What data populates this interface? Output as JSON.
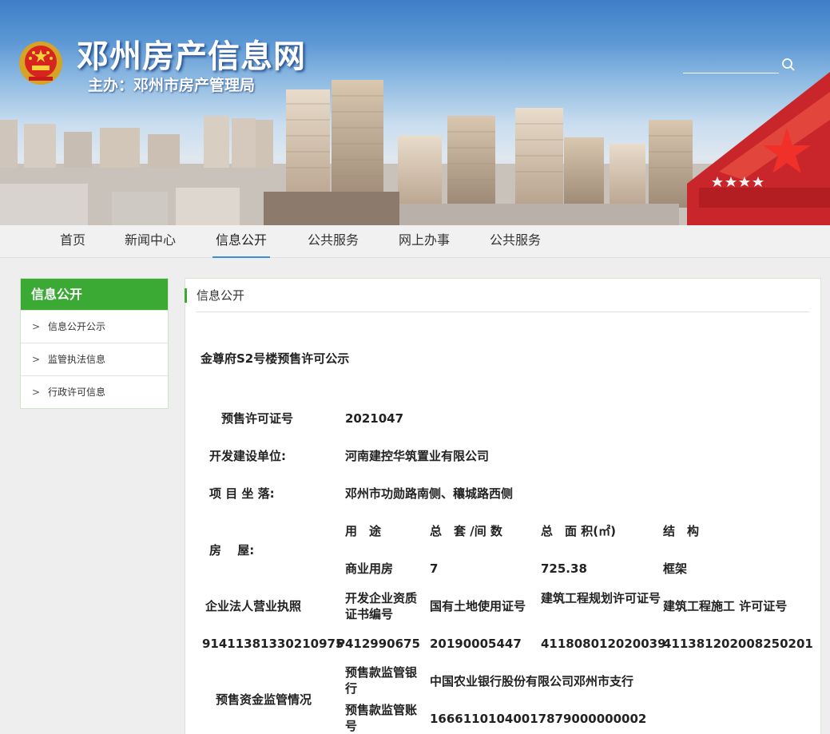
{
  "header": {
    "site_title": "邓州房产信息网",
    "subtitle": "主办：邓州市房产管理局",
    "search_placeholder": ""
  },
  "nav": {
    "items": [
      "首页",
      "新闻中心",
      "信息公开",
      "公共服务",
      "网上办事",
      "公共服务"
    ],
    "active_index": 2
  },
  "sidebar": {
    "title": "信息公开",
    "items": [
      "信息公开公示",
      "监管执法信息",
      "行政许可信息"
    ],
    "chevron": ">"
  },
  "panel": {
    "heading": "信息公开",
    "doc_title": "金尊府S2号楼预售许可公示"
  },
  "details": {
    "permit_label": "预售许可证号",
    "permit_value": "2021047",
    "developer_label": "开发建设单位:",
    "developer_value": "河南建控华筑置业有限公司",
    "location_label": "项 目 坐 落:",
    "location_value": "邓州市功勋路南侧、穰城路西侧",
    "housing_label": "房　 屋:",
    "housing_headers": [
      "用　途",
      "总　套 /间 数",
      "总　面 积(㎡)",
      "结　构"
    ],
    "housing_row": [
      "商业用房",
      "7",
      "725.38",
      "框架"
    ],
    "license_headers": [
      "企业法人营业执照",
      "开发企业资质证书编号",
      "国有土地使用证号",
      "建筑工程规划许可证号",
      "建筑工程施工 许可证号"
    ],
    "license_values": [
      "91411381330210975",
      "P412990675",
      "20190005447",
      "411808012020039",
      "411381202008250201"
    ],
    "escrow_label": "预售资金监管情况",
    "escrow_bank_label": "预售款监管银行",
    "escrow_bank_value": "中国农业银行股份有限公司邓州市支行",
    "escrow_account_label": "预售款监管账号",
    "escrow_account_value": "16661101040017879000000002"
  },
  "colors": {
    "sidebar_green": "#3aaa35",
    "nav_active": "#3a8fd8",
    "banner_blue": "#3f7ec7"
  },
  "icons": [
    "emblem-icon",
    "search-icon",
    "chevron-right-icon"
  ]
}
